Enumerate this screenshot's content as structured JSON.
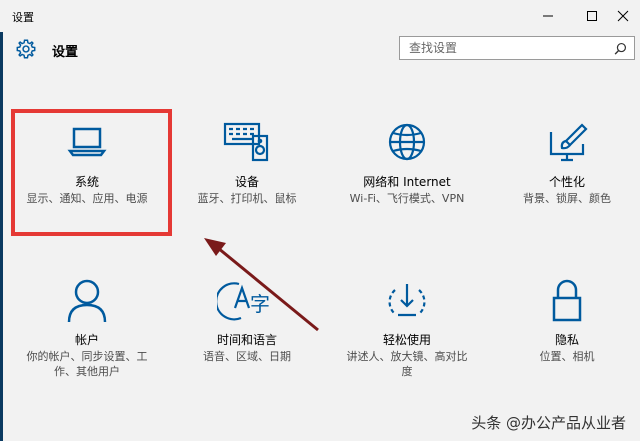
{
  "window": {
    "title": "设置",
    "controls": [
      "minimize",
      "maximize",
      "close"
    ]
  },
  "header": {
    "title": "设置",
    "icon": "gear-icon"
  },
  "search": {
    "placeholder": "查找设置"
  },
  "tiles": [
    {
      "name": "系统",
      "desc": "显示、通知、应用、电源",
      "icon": "laptop-icon",
      "highlighted": true
    },
    {
      "name": "设备",
      "desc": "蓝牙、打印机、鼠标",
      "icon": "devices-icon",
      "highlighted": false
    },
    {
      "name": "网络和 Internet",
      "desc": "Wi-Fi、飞行模式、VPN",
      "icon": "globe-icon",
      "highlighted": false
    },
    {
      "name": "个性化",
      "desc": "背景、锁屏、颜色",
      "icon": "paint-icon",
      "highlighted": false
    },
    {
      "name": "帐户",
      "desc": "你的帐户、同步设置、工作、其他用户",
      "icon": "person-icon",
      "highlighted": false
    },
    {
      "name": "时间和语言",
      "desc": "语音、区域、日期",
      "icon": "time-language-icon",
      "highlighted": false
    },
    {
      "name": "轻松使用",
      "desc": "讲述人、放大镜、高对比度",
      "icon": "ease-of-access-icon",
      "highlighted": false
    },
    {
      "name": "隐私",
      "desc": "位置、相机",
      "icon": "lock-icon",
      "highlighted": false
    }
  ],
  "watermark": "头条 @办公产品从业者",
  "colors": {
    "accent": "#005a9e",
    "highlight": "#e53935",
    "arrow": "#7a1a1a",
    "background": "#f2f2f2"
  }
}
